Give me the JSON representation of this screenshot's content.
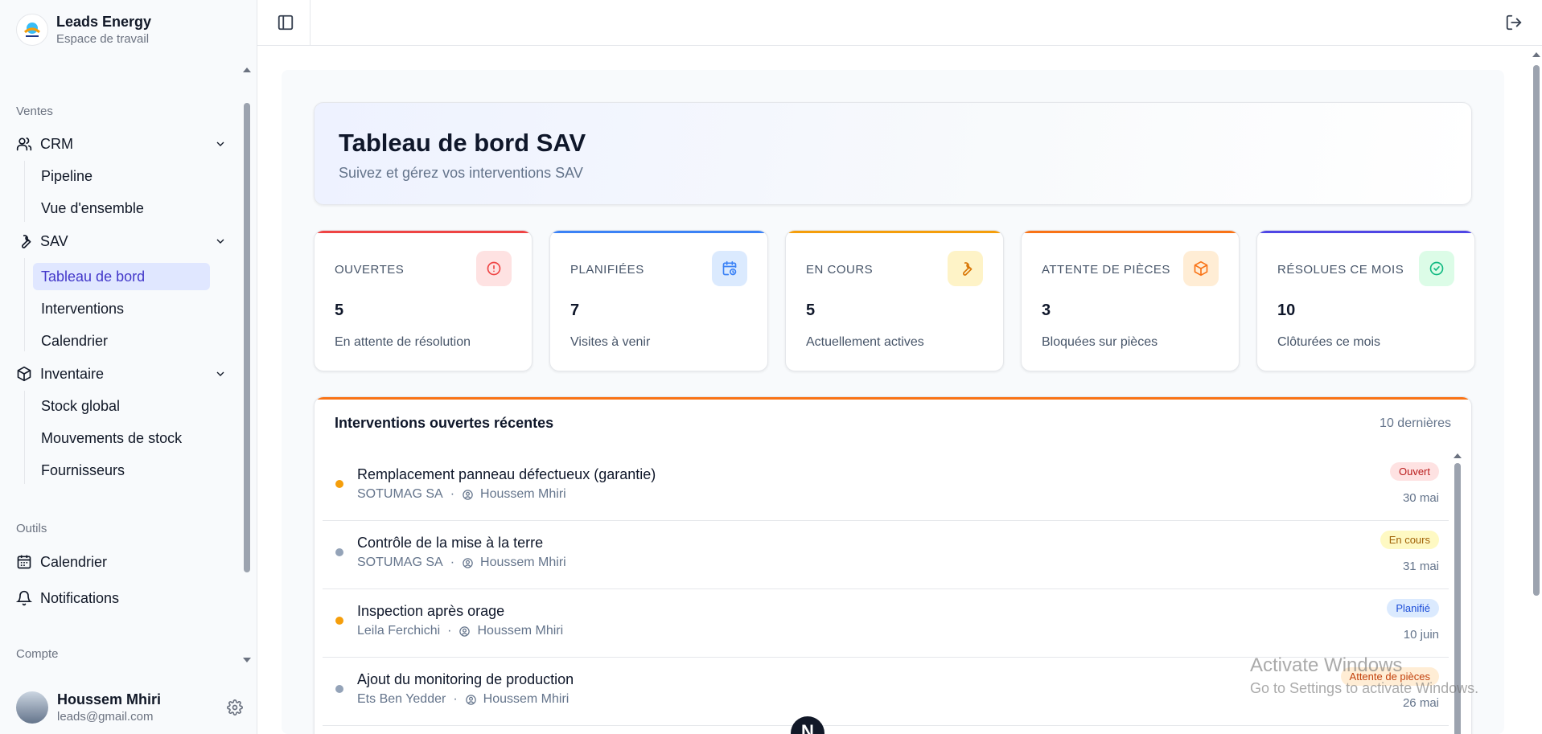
{
  "brand": {
    "name": "Leads Energy",
    "subtitle": "Espace de travail"
  },
  "sidebar": {
    "sections": {
      "ventes": "Ventes",
      "outils": "Outils",
      "compte": "Compte"
    },
    "crm": {
      "label": "CRM",
      "items": [
        "Pipeline",
        "Vue d'ensemble"
      ]
    },
    "sav": {
      "label": "SAV",
      "items": [
        "Tableau de bord",
        "Interventions",
        "Calendrier"
      ]
    },
    "inventaire": {
      "label": "Inventaire",
      "items": [
        "Stock global",
        "Mouvements de stock",
        "Fournisseurs"
      ]
    },
    "tools": {
      "calendar": "Calendrier",
      "notifications": "Notifications"
    },
    "user": {
      "name": "Houssem Mhiri",
      "email": "leads@gmail.com"
    }
  },
  "hero": {
    "title": "Tableau de bord SAV",
    "subtitle": "Suivez et gérez vos interventions SAV"
  },
  "stats": [
    {
      "label": "OUVERTES",
      "value": "5",
      "desc": "En attente de résolution",
      "color": "#ef4444",
      "icon": "alert-circle-icon"
    },
    {
      "label": "PLANIFIÉES",
      "value": "7",
      "desc": "Visites à venir",
      "color": "#3b82f6",
      "icon": "calendar-clock-icon"
    },
    {
      "label": "EN COURS",
      "value": "5",
      "desc": "Actuellement actives",
      "color": "#f59e0b",
      "icon": "wrench-icon"
    },
    {
      "label": "ATTENTE DE PIÈCES",
      "value": "3",
      "desc": "Bloquées sur pièces",
      "color": "#f97316",
      "icon": "package-icon"
    },
    {
      "label": "RÉSOLUES CE MOIS",
      "value": "10",
      "desc": "Clôturées ce mois",
      "color": "#10b981",
      "icon": "check-circle-icon"
    }
  ],
  "recent": {
    "title": "Interventions ouvertes récentes",
    "count": "10 dernières",
    "rows": [
      {
        "title": "Remplacement panneau défectueux (garantie)",
        "client": "SOTUMAG SA",
        "tech": "Houssem Mhiri",
        "status": "Ouvert",
        "date": "30 mai",
        "dot": "#f59e0b"
      },
      {
        "title": "Contrôle de la mise à la terre",
        "client": "SOTUMAG SA",
        "tech": "Houssem Mhiri",
        "status": "En cours",
        "date": "31 mai",
        "dot": "#94a3b8"
      },
      {
        "title": "Inspection après orage",
        "client": "Leila Ferchichi",
        "tech": "Houssem Mhiri",
        "status": "Planifié",
        "date": "10 juin",
        "dot": "#f59e0b"
      },
      {
        "title": "Ajout du monitoring de production",
        "client": "Ets Ben Yedder",
        "tech": "Houssem Mhiri",
        "status": "Attente de pièces",
        "date": "26 mai",
        "dot": "#94a3b8"
      }
    ]
  },
  "watermark": {
    "line1": "Activate Windows",
    "line2": "Go to Settings to activate Windows."
  },
  "fab": {
    "label": "N"
  }
}
